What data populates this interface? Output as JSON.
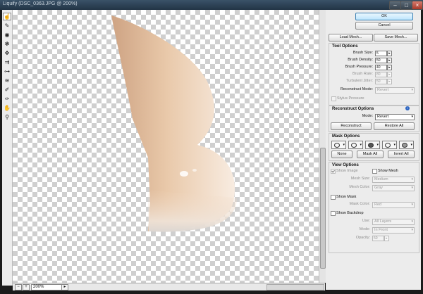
{
  "window": {
    "title": "Liquify (DSC_0363.JPG @ 200%)"
  },
  "toolbar": {
    "tools": [
      {
        "name": "forward-warp-tool",
        "glyph": "☝"
      },
      {
        "name": "reconstruct-tool",
        "glyph": "✎"
      },
      {
        "name": "twirl-tool",
        "glyph": "◉"
      },
      {
        "name": "pucker-tool",
        "glyph": "❃"
      },
      {
        "name": "bloat-tool",
        "glyph": "✥"
      },
      {
        "name": "push-left-tool",
        "glyph": "⇉"
      },
      {
        "name": "mirror-tool",
        "glyph": "⊶"
      },
      {
        "name": "turbulence-tool",
        "glyph": "≋"
      },
      {
        "name": "freeze-mask-tool",
        "glyph": "✐"
      },
      {
        "name": "thaw-mask-tool",
        "glyph": "✑"
      },
      {
        "name": "hand-tool",
        "glyph": "✋"
      },
      {
        "name": "zoom-tool",
        "glyph": "⚲"
      }
    ]
  },
  "status": {
    "zoom": "200%",
    "minus": "−",
    "plus": "+"
  },
  "panel": {
    "ok": "OK",
    "cancel": "Cancel",
    "load_mesh": "Load Mesh...",
    "save_mesh": "Save Mesh...",
    "tool_options": {
      "title": "Tool Options",
      "brush_size": {
        "label": "Brush Size:",
        "value": "5"
      },
      "brush_density": {
        "label": "Brush Density:",
        "value": "50"
      },
      "brush_pressure": {
        "label": "Brush Pressure:",
        "value": "40"
      },
      "brush_rate": {
        "label": "Brush Rate:",
        "value": "80"
      },
      "turbulent_jitter": {
        "label": "Turbulent Jitter:",
        "value": "50"
      },
      "reconstruct_mode": {
        "label": "Reconstruct Mode:",
        "value": "Revert"
      },
      "stylus_pressure": "Stylus Pressure"
    },
    "reconstruct_options": {
      "title": "Reconstruct Options",
      "mode": {
        "label": "Mode:",
        "value": "Revert"
      },
      "reconstruct": "Reconstruct",
      "restore_all": "Restore All"
    },
    "mask_options": {
      "title": "Mask Options",
      "none": "None",
      "mask_all": "Mask All",
      "invert_all": "Invert All"
    },
    "view_options": {
      "title": "View Options",
      "show_image": "Show Image",
      "show_mesh": "Show Mesh",
      "mesh_size": {
        "label": "Mesh Size:",
        "value": "Medium"
      },
      "mesh_color": {
        "label": "Mesh Color:",
        "value": "Gray"
      },
      "show_mask": "Show Mask",
      "mask_color": {
        "label": "Mask Color:",
        "value": "Red"
      },
      "show_backdrop": "Show Backdrop",
      "use": {
        "label": "Use:",
        "value": "All Layers"
      },
      "mode": {
        "label": "Mode:",
        "value": "In Front"
      },
      "opacity": {
        "label": "Opacity:",
        "value": "50"
      }
    }
  },
  "colors": {
    "shape_light": "#f7e6d6",
    "shape_mid": "#e7c6a7",
    "shape_dark": "#cfa584",
    "checker": "#cfcfcf",
    "panel_bg": "#ececec"
  }
}
